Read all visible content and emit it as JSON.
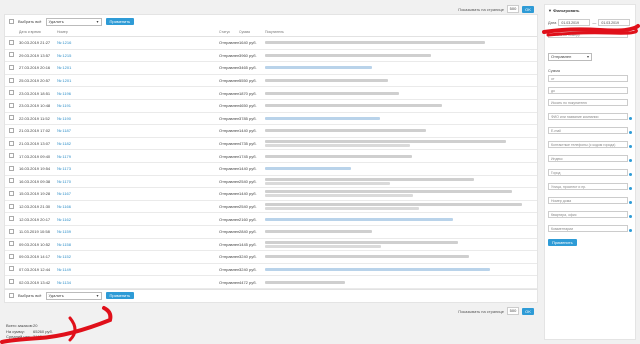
{
  "top_pager": {
    "label": "Показывать на странице",
    "value": "500",
    "ok": "OK"
  },
  "bulk": {
    "select_all": "Выбрать всё",
    "action": "Удалить",
    "apply": "Применить"
  },
  "table": {
    "headers": [
      "Дата и время",
      "Номер",
      "Статус",
      "Сумма",
      "Покупатель"
    ],
    "rows": [
      {
        "date": "30.03.2019 21:27",
        "num": "№ 1216",
        "status": "Отправлен",
        "sum": "1640 руб."
      },
      {
        "date": "29.03.2019 13:57",
        "num": "№ 1215",
        "status": "Отправлен",
        "sum": "3960 руб."
      },
      {
        "date": "27.03.2019 20:16",
        "num": "№ 1201",
        "status": "Отправлен",
        "sum": "3465 руб."
      },
      {
        "date": "25.03.2019 20:57",
        "num": "№ 1201",
        "status": "Отправлен",
        "sum": "5550 руб."
      },
      {
        "date": "23.03.2019 18:51",
        "num": "№ 1196",
        "status": "Отправлен",
        "sum": "1870 руб."
      },
      {
        "date": "23.03.2019 10:48",
        "num": "№ 1191",
        "status": "Отправлен",
        "sum": "4650 руб."
      },
      {
        "date": "22.03.2019 11:52",
        "num": "№ 1190",
        "status": "Отправлен",
        "sum": "3785 руб."
      },
      {
        "date": "21.03.2019 17:02",
        "num": "№ 1187",
        "status": "Отправлен",
        "sum": "1440 руб."
      },
      {
        "date": "21.03.2019 13:07",
        "num": "№ 1182",
        "status": "Отправлен",
        "sum": "4735 руб."
      },
      {
        "date": "17.03.2019 09:40",
        "num": "№ 1179",
        "status": "Отправлен",
        "sum": "1745 руб."
      },
      {
        "date": "16.03.2019 19:54",
        "num": "№ 1173",
        "status": "Отправлен",
        "sum": "1440 руб."
      },
      {
        "date": "16.03.2019 09:38",
        "num": "№ 1170",
        "status": "Отправлен",
        "sum": "2540 руб."
      },
      {
        "date": "15.03.2019 19:28",
        "num": "№ 1167",
        "status": "Отправлен",
        "sum": "1440 руб."
      },
      {
        "date": "12.03.2019 21:30",
        "num": "№ 1166",
        "status": "Отправлен",
        "sum": "2540 руб."
      },
      {
        "date": "12.03.2019 20:17",
        "num": "№ 1162",
        "status": "Отправлен",
        "sum": "2160 руб."
      },
      {
        "date": "11.03.2019 10:58",
        "num": "№ 1159",
        "status": "Отправлен",
        "sum": "2840 руб."
      },
      {
        "date": "09.03.2019 10:52",
        "num": "№ 1158",
        "status": "Отправлен",
        "sum": "1445 руб."
      },
      {
        "date": "09.03.2019 14:17",
        "num": "№ 1152",
        "status": "Отправлен",
        "sum": "3240 руб."
      },
      {
        "date": "07.03.2019 12:44",
        "num": "№ 1149",
        "status": "Отправлен",
        "sum": "3240 руб."
      },
      {
        "date": "02.03.2019 13:42",
        "num": "№ 1134",
        "status": "Отправлен",
        "sum": "4472 руб."
      }
    ]
  },
  "bottom_pager": {
    "label": "Показывать на странице",
    "value": "500",
    "ok": "OK"
  },
  "totals": {
    "count_label": "Всего заказов:",
    "count": "20",
    "sum_label": "На сумму:",
    "sum": "65260 руб.",
    "avg_label": "Средний чек:",
    "avg": "3163 руб."
  },
  "filter": {
    "title": "Фильтровать",
    "date_label": "Дата",
    "date_from": "01.03.2019",
    "date_to": "01.03.2019",
    "fields": [
      "Искать по номеру",
      "",
      "",
      "",
      "",
      "",
      "",
      "",
      ""
    ],
    "status_value": "Отправлен",
    "sum_label": "Сумма",
    "sum_from": "от",
    "sum_to": "до",
    "buyer": "Искать по покупателю",
    "extra": [
      "ФИО или название компании",
      "E-mail",
      "Контактные телефоны (с кодом города)",
      "Индекс",
      "Город",
      "Улица, проспект и пр.",
      "Номер дома",
      "Квартира, офис",
      "Комментарии"
    ],
    "apply": "Применить"
  },
  "colors": {
    "accent": "#2e9bd6",
    "annotation": "#e0101a"
  }
}
